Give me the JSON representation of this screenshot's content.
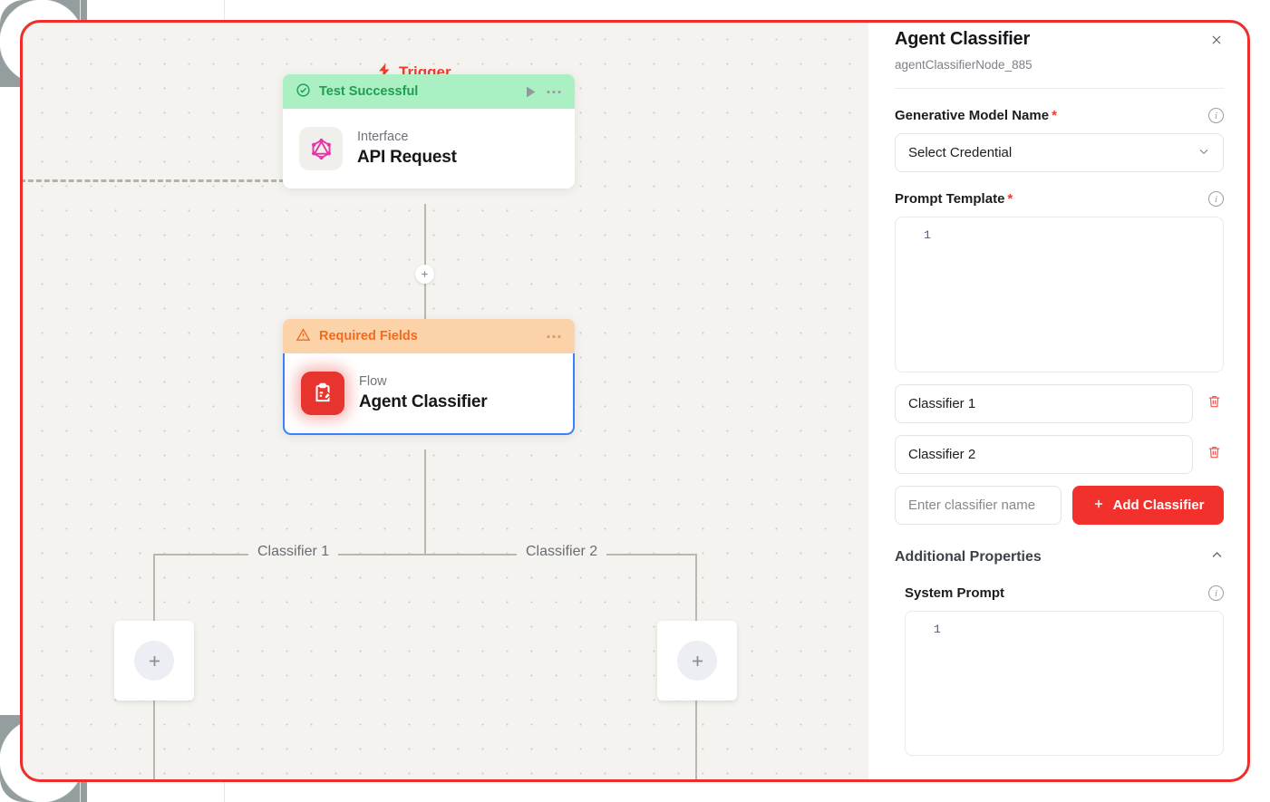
{
  "canvas": {
    "trigger_label": "Trigger",
    "branch_labels": [
      "Classifier 1",
      "Classifier 2"
    ],
    "nodes": [
      {
        "status_label": "Test Successful",
        "status_type": "success",
        "kind": "Interface",
        "title": "API Request",
        "icon": "graphql-icon",
        "status_color": "#1f9e52",
        "header_bg": "#aaf0c2"
      },
      {
        "status_label": "Required Fields",
        "status_type": "warning",
        "kind": "Flow",
        "title": "Agent Classifier",
        "icon": "clipboard-edit-icon",
        "status_color": "#ef6b20",
        "header_bg": "#fcd3a8"
      }
    ],
    "add_node_plus": "+",
    "edge_plus": "+"
  },
  "panel": {
    "title": "Agent Classifier",
    "node_id": "agentClassifierNode_885",
    "close_label": "×",
    "fields": {
      "model": {
        "label": "Generative Model Name",
        "required": "*",
        "value": "Select Credential",
        "chevron": "chevron-down-icon"
      },
      "prompt_template": {
        "label": "Prompt Template",
        "required": "*",
        "line_number": "1",
        "value": ""
      },
      "system_prompt": {
        "label": "System Prompt",
        "required": "",
        "line_number": "1",
        "value": ""
      }
    },
    "classifiers": [
      {
        "value": "Classifier 1"
      },
      {
        "value": "Classifier 2"
      }
    ],
    "add_classifier": {
      "placeholder": "Enter classifier name",
      "value": "",
      "button_label": "Add Classifier",
      "button_plus": "+",
      "button_color": "#f2312c"
    },
    "additional_properties": {
      "label": "Additional Properties",
      "chevron": "chevron-up-icon",
      "expanded": true
    },
    "info_icon_glyph": "i"
  },
  "theme": {
    "accent_red": "#ee2d2d",
    "canvas_bg": "#f4f3ef",
    "selection_blue": "#3b82f6",
    "success_green": "#1f9e52",
    "warning_orange": "#ef6b20"
  }
}
